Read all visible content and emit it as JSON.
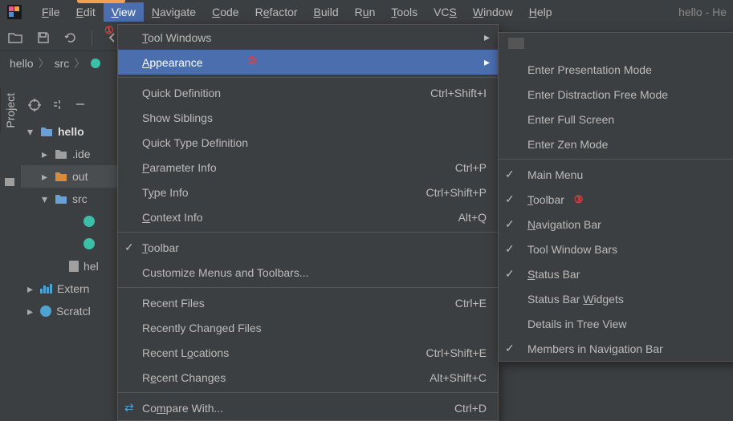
{
  "window_title": "hello - He",
  "menubar": {
    "items": [
      "File",
      "Edit",
      "View",
      "Navigate",
      "Code",
      "Refactor",
      "Build",
      "Run",
      "Tools",
      "VCS",
      "Window",
      "Help"
    ],
    "underline_idx": [
      0,
      0,
      0,
      0,
      0,
      1,
      0,
      1,
      0,
      2,
      0,
      0
    ],
    "active_index": 2
  },
  "annotations": {
    "one": "①",
    "two": "②",
    "three": "③"
  },
  "breadcrumb": [
    "hello",
    "src"
  ],
  "sidebar_tab": "Project",
  "tree": {
    "root": "hello",
    "items": [
      {
        "label": ".ide",
        "icon": "folder-gray",
        "indent": 1
      },
      {
        "label": "out",
        "icon": "folder-orange",
        "indent": 1,
        "selected": true
      },
      {
        "label": "src",
        "icon": "folder-blue",
        "indent": 1,
        "expanded": true
      },
      {
        "label": "",
        "icon": "circle",
        "indent": 3
      },
      {
        "label": "",
        "icon": "circle",
        "indent": 3
      },
      {
        "label": "hel",
        "icon": "file",
        "indent": 2
      },
      {
        "label": "Extern",
        "icon": "chart",
        "indent": 0
      },
      {
        "label": "Scratcl",
        "icon": "clock",
        "indent": 0
      }
    ]
  },
  "view_menu": [
    {
      "type": "item",
      "label": "Tool Windows",
      "ul": 0,
      "sub": true
    },
    {
      "type": "item",
      "label": "Appearance",
      "ul": 0,
      "sub": true,
      "highlight": true
    },
    {
      "type": "sep"
    },
    {
      "type": "item",
      "label": "Quick Definition",
      "shortcut": "Ctrl+Shift+I"
    },
    {
      "type": "item",
      "label": "Show Siblings"
    },
    {
      "type": "item",
      "label": "Quick Type Definition"
    },
    {
      "type": "item",
      "label": "Parameter Info",
      "ul": 0,
      "shortcut": "Ctrl+P"
    },
    {
      "type": "item",
      "label": "Type Info",
      "ul": 1,
      "shortcut": "Ctrl+Shift+P"
    },
    {
      "type": "item",
      "label": "Context Info",
      "ul": 0,
      "shortcut": "Alt+Q"
    },
    {
      "type": "sep"
    },
    {
      "type": "item",
      "label": "Toolbar",
      "ul": 0,
      "check": true
    },
    {
      "type": "item",
      "label": "Customize Menus and Toolbars..."
    },
    {
      "type": "sep"
    },
    {
      "type": "item",
      "label": "Recent Files",
      "shortcut": "Ctrl+E"
    },
    {
      "type": "item",
      "label": "Recently Changed Files"
    },
    {
      "type": "item",
      "label": "Recent Locations",
      "ul": 8,
      "shortcut": "Ctrl+Shift+E"
    },
    {
      "type": "item",
      "label": "Recent Changes",
      "ul": 1,
      "shortcut": "Alt+Shift+C"
    },
    {
      "type": "sep"
    },
    {
      "type": "item",
      "label": "Compare With...",
      "ul": 2,
      "shortcut": "Ctrl+D",
      "icon": "compare"
    }
  ],
  "appearance_menu": [
    {
      "label": "Enter Presentation Mode"
    },
    {
      "label": "Enter Distraction Free Mode"
    },
    {
      "label": "Enter Full Screen"
    },
    {
      "label": "Enter Zen Mode"
    },
    {
      "sep": true
    },
    {
      "label": "Main Menu",
      "check": true
    },
    {
      "label": "Toolbar",
      "ul": 0,
      "check": true,
      "annot": true
    },
    {
      "label": "Navigation Bar",
      "ul": 0,
      "check": true
    },
    {
      "label": "Tool Window Bars",
      "check": true
    },
    {
      "label": "Status Bar",
      "ul": 0,
      "check": true
    },
    {
      "label": "Status Bar Widgets",
      "ul": 11,
      "sub": true
    },
    {
      "label": "Details in Tree View"
    },
    {
      "label": "Members in Navigation Bar",
      "check": true
    }
  ]
}
